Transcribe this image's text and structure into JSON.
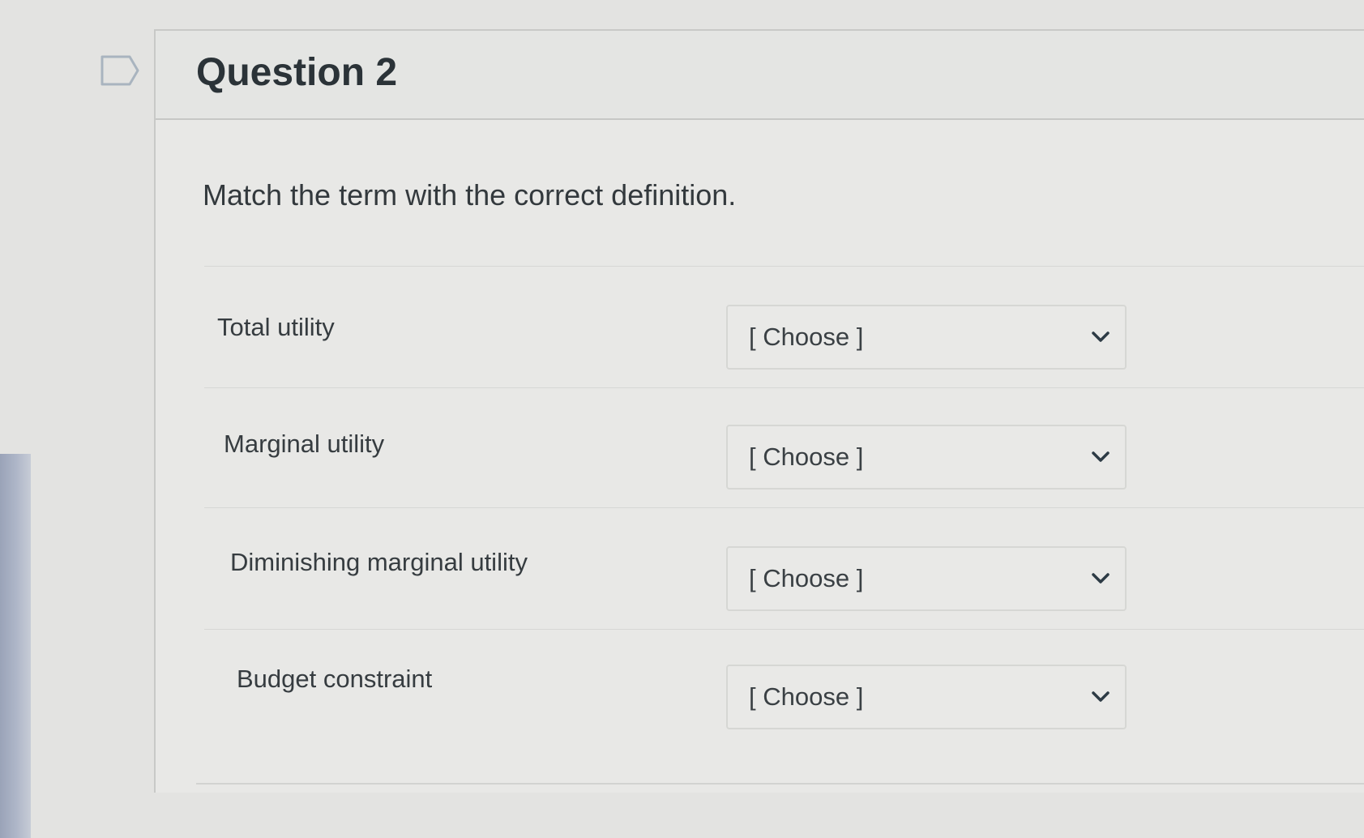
{
  "question": {
    "title": "Question 2",
    "prompt": "Match the term with the correct definition."
  },
  "matches": [
    {
      "term": "Total utility",
      "selected": "[ Choose ]"
    },
    {
      "term": "Marginal utility",
      "selected": "[ Choose ]"
    },
    {
      "term": "Diminishing marginal utility",
      "selected": "[ Choose ]"
    },
    {
      "term": "Budget constraint",
      "selected": "[ Choose ]"
    }
  ],
  "icons": {
    "flag": "flag-outline-icon",
    "dropdown": "chevron-down-icon"
  },
  "colors": {
    "background": "#e3e3e1",
    "text": "#2d3b45",
    "border": "#d6d7d4"
  }
}
